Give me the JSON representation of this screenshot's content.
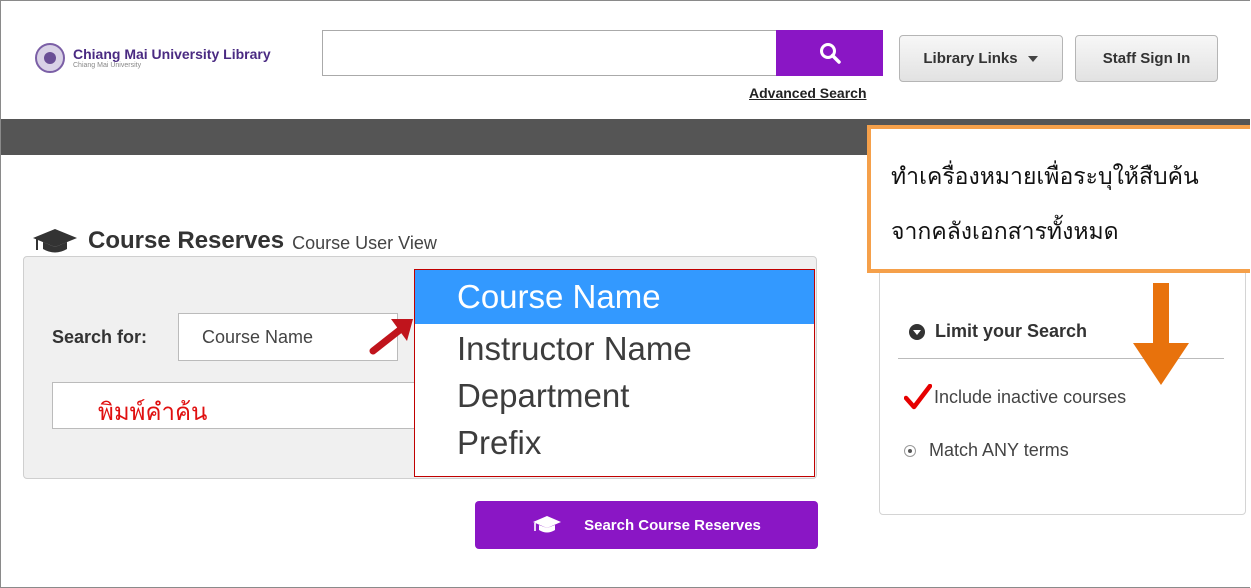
{
  "header": {
    "logo_title": "Chiang Mai University Library",
    "logo_subtitle": "Chiang Mai University",
    "search_value": "",
    "advanced_search": "Advanced Search",
    "library_links": "Library Links",
    "staff_sign_in": "Staff Sign In"
  },
  "page": {
    "title": "Course Reserves",
    "subtitle": "Course User View"
  },
  "search_form": {
    "search_for_label": "Search for:",
    "search_for_value": "Course Name",
    "term_value": "พิมพ์คำค้น",
    "dropdown_options": [
      "Course Name",
      "Instructor Name",
      "Department",
      "Prefix"
    ],
    "selected_option": "Course Name",
    "submit_label": "Search Course Reserves"
  },
  "sidebar": {
    "limit_title": "Limit your Search",
    "include_inactive": "Include inactive courses",
    "match_any": "Match ANY terms"
  },
  "annotation": {
    "line1": "ทำเครื่องหมายเพื่อระบุให้สืบค้น",
    "line2": "จากคลังเอกสารทั้งหมด"
  },
  "colors": {
    "purple": "#8a16c5",
    "navbar": "#555555",
    "dropdown_highlight": "#3399ff",
    "annotation_border": "#f5a04a",
    "annotation_arrow": "#e8720c",
    "pointer_arrow": "#c0141c",
    "checkmark": "#e60000"
  }
}
